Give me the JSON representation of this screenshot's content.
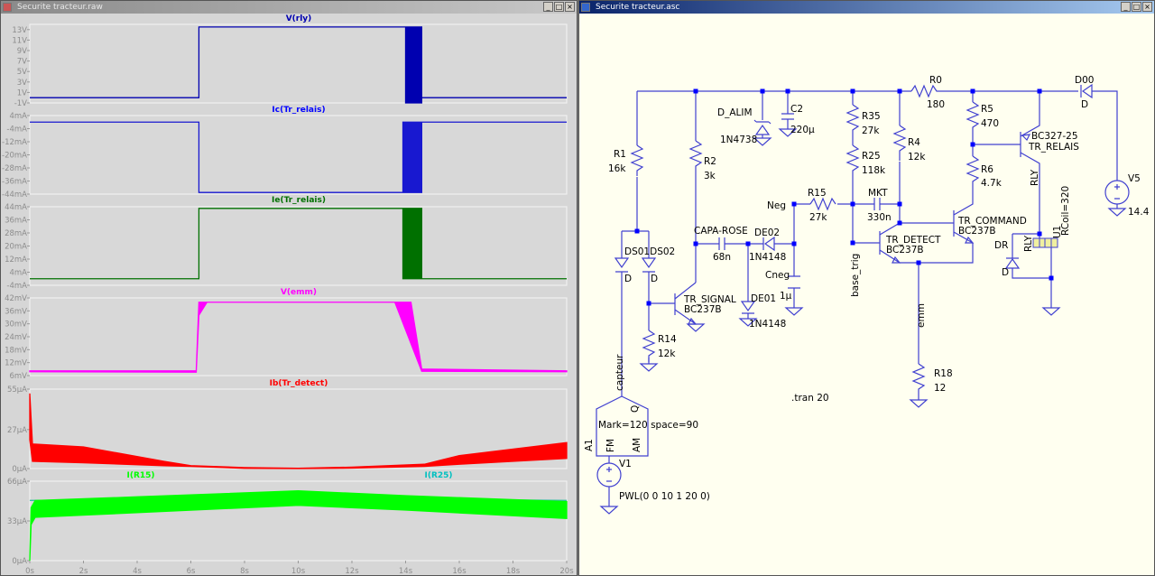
{
  "waveform_window": {
    "title": "Securite tracteur.raw",
    "controls": [
      "_",
      "□",
      "×"
    ]
  },
  "schematic_window": {
    "title": "Securite tracteur.asc",
    "controls": [
      "_",
      "□",
      "×"
    ]
  },
  "time_axis": {
    "range": [
      0,
      20
    ],
    "unit": "s",
    "ticks": [
      "0s",
      "2s",
      "4s",
      "6s",
      "8s",
      "10s",
      "12s",
      "14s",
      "16s",
      "18s",
      "20s"
    ]
  },
  "panes": [
    {
      "traces": [
        {
          "label": "V(rly)",
          "color": "#0000b0"
        }
      ],
      "yrange": [
        -1,
        14
      ],
      "ticks": [
        {
          "v": 13,
          "t": "13V"
        },
        {
          "v": 11,
          "t": "11V"
        },
        {
          "v": 9,
          "t": "9V"
        },
        {
          "v": 7,
          "t": "7V"
        },
        {
          "v": 5,
          "t": "5V"
        },
        {
          "v": 3,
          "t": "3V"
        },
        {
          "v": 1,
          "t": "1V"
        },
        {
          "v": -1,
          "t": "-1V"
        }
      ],
      "data": [
        {
          "color": "#0000b0",
          "min": [
            [
              0,
              0
            ],
            [
              6.3,
              0
            ],
            [
              6.3,
              13.5
            ],
            [
              14.0,
              13.5
            ],
            [
              14.0,
              -1
            ],
            [
              14.6,
              -1
            ],
            [
              14.6,
              0
            ],
            [
              20,
              0
            ]
          ],
          "max": [
            [
              0,
              0
            ],
            [
              6.3,
              0
            ],
            [
              6.3,
              13.5
            ],
            [
              14.0,
              13.5
            ],
            [
              14.0,
              13.5
            ],
            [
              14.6,
              13.5
            ],
            [
              14.6,
              0
            ],
            [
              20,
              0
            ]
          ]
        }
      ]
    },
    {
      "traces": [
        {
          "label": "Ic(Tr_relais)",
          "color": "#0000ff"
        }
      ],
      "yrange": [
        -44,
        4
      ],
      "ticks": [
        {
          "v": 4,
          "t": "4mA"
        },
        {
          "v": -4,
          "t": "-4mA"
        },
        {
          "v": -12,
          "t": "-12mA"
        },
        {
          "v": -20,
          "t": "-20mA"
        },
        {
          "v": -28,
          "t": "-28mA"
        },
        {
          "v": -36,
          "t": "-36mA"
        },
        {
          "v": -44,
          "t": "-44mA"
        }
      ],
      "data": [
        {
          "color": "#1818d0",
          "min": [
            [
              0,
              0
            ],
            [
              6.3,
              0
            ],
            [
              6.3,
              -43
            ],
            [
              13.9,
              -43
            ],
            [
              14.6,
              -43
            ],
            [
              14.6,
              0
            ],
            [
              20,
              0
            ]
          ],
          "max": [
            [
              0,
              0
            ],
            [
              6.3,
              0
            ],
            [
              6.3,
              -43
            ],
            [
              13.9,
              -43
            ],
            [
              13.9,
              0
            ],
            [
              14.6,
              0
            ],
            [
              20,
              0
            ]
          ]
        }
      ]
    },
    {
      "traces": [
        {
          "label": "Ie(Tr_relais)",
          "color": "#007000"
        }
      ],
      "yrange": [
        -4,
        44
      ],
      "ticks": [
        {
          "v": 44,
          "t": "44mA"
        },
        {
          "v": 36,
          "t": "36mA"
        },
        {
          "v": 28,
          "t": "28mA"
        },
        {
          "v": 20,
          "t": "20mA"
        },
        {
          "v": 12,
          "t": "12mA"
        },
        {
          "v": 4,
          "t": "4mA"
        },
        {
          "v": -4,
          "t": "-4mA"
        }
      ],
      "data": [
        {
          "color": "#007000",
          "min": [
            [
              0,
              0
            ],
            [
              6.3,
              0
            ],
            [
              6.3,
              43
            ],
            [
              13.9,
              43
            ],
            [
              13.9,
              0
            ],
            [
              14.6,
              0
            ],
            [
              20,
              0
            ]
          ],
          "max": [
            [
              0,
              0
            ],
            [
              6.3,
              0
            ],
            [
              6.3,
              43
            ],
            [
              13.9,
              43
            ],
            [
              14.6,
              43
            ],
            [
              14.6,
              0
            ],
            [
              20,
              0
            ]
          ]
        }
      ]
    },
    {
      "traces": [
        {
          "label": "V(emm)",
          "color": "#ff00ff"
        }
      ],
      "yrange": [
        6,
        42
      ],
      "ticks": [
        {
          "v": 42,
          "t": "42mV"
        },
        {
          "v": 36,
          "t": "36mV"
        },
        {
          "v": 30,
          "t": "30mV"
        },
        {
          "v": 24,
          "t": "24mV"
        },
        {
          "v": 18,
          "t": "18mV"
        },
        {
          "v": 12,
          "t": "12mV"
        },
        {
          "v": 6,
          "t": "6mV"
        }
      ],
      "data": [
        {
          "color": "#ff00ff",
          "min": [
            [
              0,
              7.8
            ],
            [
              6.2,
              7.6
            ],
            [
              6.3,
              34
            ],
            [
              6.6,
              40
            ],
            [
              13.6,
              40
            ],
            [
              14.6,
              8
            ],
            [
              20,
              7.8
            ]
          ],
          "max": [
            [
              0,
              8.2
            ],
            [
              6.2,
              8.2
            ],
            [
              6.3,
              40
            ],
            [
              13.6,
              40
            ],
            [
              14.2,
              40
            ],
            [
              14.6,
              9
            ],
            [
              20,
              8.2
            ]
          ]
        }
      ]
    },
    {
      "traces": [
        {
          "label": "Ib(Tr_detect)",
          "color": "#ff0000"
        }
      ],
      "yrange": [
        0,
        55
      ],
      "ticks": [
        {
          "v": 55,
          "t": "55µA"
        },
        {
          "v": 27,
          "t": "27µA"
        },
        {
          "v": 0,
          "t": "0µA"
        }
      ],
      "data": [
        {
          "color": "#ff0000",
          "min": [
            [
              0,
              20
            ],
            [
              0.1,
              5
            ],
            [
              2,
              4
            ],
            [
              5,
              2
            ],
            [
              6,
              1.5
            ],
            [
              8,
              0.2
            ],
            [
              10,
              0
            ],
            [
              12,
              0.3
            ],
            [
              14.7,
              1.5
            ],
            [
              16,
              3
            ],
            [
              20,
              7
            ]
          ],
          "max": [
            [
              0,
              52
            ],
            [
              0.1,
              17
            ],
            [
              2,
              15
            ],
            [
              5,
              5
            ],
            [
              6,
              2
            ],
            [
              8,
              0.7
            ],
            [
              10,
              0.2
            ],
            [
              12,
              1
            ],
            [
              14.7,
              3
            ],
            [
              16,
              9
            ],
            [
              20,
              18
            ]
          ]
        }
      ]
    },
    {
      "traces": [
        {
          "label": "I(R15)",
          "color": "#00ff00"
        },
        {
          "label": "I(R25)",
          "color": "#00c0c0"
        }
      ],
      "yrange": [
        0,
        66
      ],
      "ticks": [
        {
          "v": 66,
          "t": "66µA"
        },
        {
          "v": 33,
          "t": "33µA"
        },
        {
          "v": 0,
          "t": "0µA"
        }
      ],
      "data": [
        {
          "color": "#00ff00",
          "min": [
            [
              0,
              0
            ],
            [
              0.05,
              30
            ],
            [
              0.2,
              36
            ],
            [
              10,
              46
            ],
            [
              14,
              42
            ],
            [
              20,
              35
            ]
          ],
          "max": [
            [
              0,
              0
            ],
            [
              0.05,
              44
            ],
            [
              0.2,
              50
            ],
            [
              4,
              53
            ],
            [
              10,
              58
            ],
            [
              14,
              54
            ],
            [
              20,
              49
            ]
          ]
        },
        {
          "color": "#30c0a0",
          "min": [
            [
              0,
              50
            ],
            [
              10,
              52
            ],
            [
              20,
              50
            ]
          ],
          "max": [
            [
              0,
              50
            ],
            [
              10,
              52
            ],
            [
              20,
              50
            ]
          ]
        }
      ]
    }
  ],
  "schematic": {
    "labels": {
      "R1": "R1",
      "R1v": "16k",
      "R2": "R2",
      "R2v": "3k",
      "R14": "R14",
      "R14v": "12k",
      "DS": "DS01DS02",
      "DS01v": "D",
      "DS02v": "D",
      "TRS": "TR_SIGNAL",
      "TRSv": "BC237B",
      "CR": "CAPA-ROSE",
      "CRv": "68n",
      "DE02": "DE02",
      "DE02v": "1N4148",
      "DE01": "DE01",
      "DE01v": "1N4148",
      "Cneg": "Cneg",
      "Cnegv": "1µ",
      "Neg": "Neg",
      "DAL": "D_ALIM",
      "DALv": "1N4738",
      "C2": "C2",
      "C2v": "220µ",
      "R35": "R35",
      "R35v": "27k",
      "R25": "R25",
      "R25v": "118k",
      "R15": "R15",
      "R15v": "27k",
      "MKT": "MKT",
      "MKTv": "330n",
      "bt": "base_trig",
      "R4": "R4",
      "R4v": "12k",
      "TRD": "TR_DETECT",
      "TRDv": "BC237B",
      "TRC": "TR_COMMAND",
      "TRCv": "BC237B",
      "emm": "emm",
      "R18": "R18",
      "R18v": "12",
      "R0": "R0",
      "R0v": "180",
      "R5": "R5",
      "R5v": "470",
      "R6": "R6",
      "R6v": "4.7k",
      "TRR": "TR_RELAIS",
      "TRRv": "BC327-25",
      "RLY": "RLY",
      "RLY2": "RLY",
      "RC": "RCoil=320",
      "U1": "U1",
      "DR": "DR",
      "DRv": "D",
      "D00": "D00",
      "D00v": "D",
      "V5": "V5",
      "V5v": "14.4",
      "cap": "capteur",
      "Q": "Q",
      "mark": "Mark=120 space=90",
      "A1": "A1",
      "FM": "FM",
      "AM": "AM",
      "V1": "V1",
      "V1v": "PWL(0 0 10 1 20 0)",
      "tran": ".tran 20"
    },
    "wire_color": "#4040d0",
    "junction_color": "#0000ff",
    "label_color": "#000000"
  }
}
